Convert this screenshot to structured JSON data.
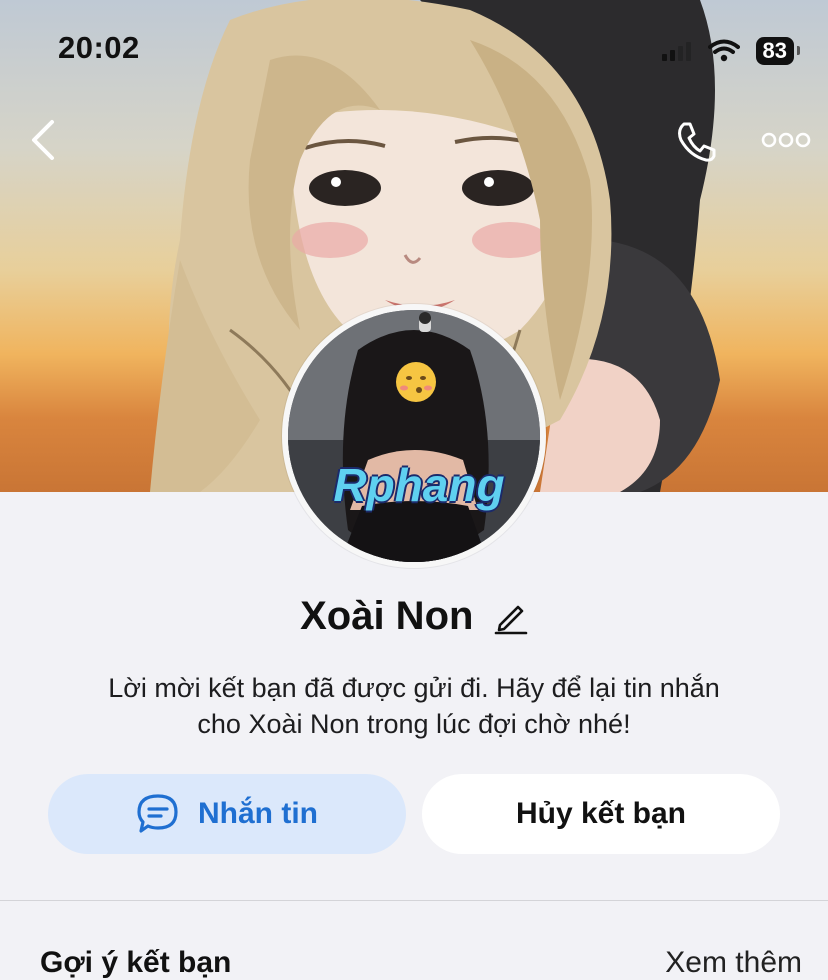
{
  "status_bar": {
    "time": "20:02",
    "battery": "83"
  },
  "profile": {
    "name": "Xoài Non",
    "watermark": "Rphang",
    "message_line1": "Lời mời kết bạn đã được gửi đi. Hãy để lại tin nhắn",
    "message_line2": "cho Xoài Non trong lúc đợi chờ nhé!"
  },
  "actions": {
    "message_label": "Nhắn tin",
    "unfriend_label": "Hủy kết bạn"
  },
  "suggestions": {
    "title": "Gợi ý kết bạn",
    "see_more": "Xem thêm"
  },
  "colors": {
    "accent": "#1f6fd1",
    "accent_bg": "#dbe8fb",
    "page_bg": "#f2f2f6"
  },
  "icons": [
    "chevron-left-icon",
    "phone-icon",
    "more-icon",
    "signal-icon",
    "wifi-icon",
    "battery-icon",
    "edit-icon",
    "chat-icon"
  ]
}
